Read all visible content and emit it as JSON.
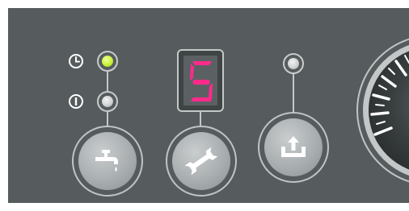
{
  "panel": {
    "background": "#565c5d"
  },
  "timer_indicator": {
    "icon": "clock-icon",
    "led_color": "#c7f23a",
    "led_state": "on"
  },
  "power_indicator": {
    "icon": "power-icon",
    "led_color": "#cfd2d3",
    "led_state": "off"
  },
  "buttons": {
    "water": {
      "icon": "tap-icon"
    },
    "service": {
      "icon": "wrench-icon"
    },
    "drain": {
      "icon": "drain-upload-icon"
    }
  },
  "display": {
    "value": "5",
    "color": "#ff2a8c"
  },
  "drain_indicator": {
    "led_color": "#cfd2d3",
    "led_state": "off"
  },
  "gauge": {
    "icon": "pressure-gauge"
  }
}
